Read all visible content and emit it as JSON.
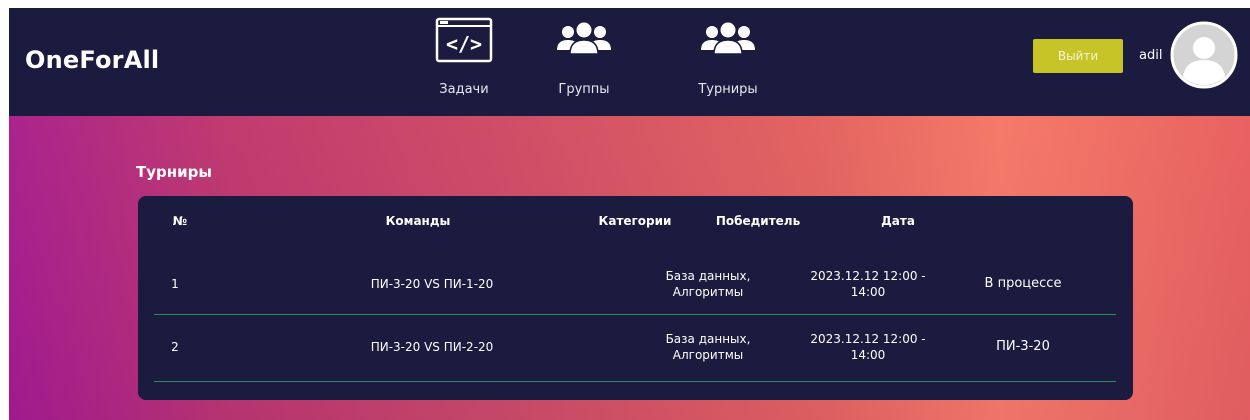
{
  "app": {
    "title": "OneForAll"
  },
  "nav": {
    "tasks_label": "Задачи",
    "groups_label": "Группы",
    "tournaments_label": "Турниры"
  },
  "user": {
    "logout_label": "Выйти",
    "username": "adil"
  },
  "page": {
    "title": "Турниры"
  },
  "table": {
    "headers": {
      "num": "№",
      "teams": "Команды",
      "categories": "Категории",
      "winner": "Победитель",
      "date": "Дата"
    },
    "rows": [
      {
        "num": "1",
        "teams": "ПИ-3-20 VS ПИ-1-20",
        "categories_line1": "База данных,",
        "categories_line2": "Алгоритмы",
        "date_line1": "2023.12.12 12:00 -",
        "date_line2": "14:00",
        "status": "В процессе"
      },
      {
        "num": "2",
        "teams": "ПИ-3-20 VS ПИ-2-20",
        "categories_line1": "База данных,",
        "categories_line2": "Алгоритмы",
        "date_line1": "2023.12.12 12:00 -",
        "date_line2": "14:00",
        "status": "ПИ-3-20"
      }
    ]
  },
  "colors": {
    "navbar": "#1a1b3e",
    "logout_button": "#c7c427",
    "row_divider": "#2f8a5b",
    "gradient_start": "#a21a90",
    "gradient_end": "#f47a68"
  },
  "icons": {
    "tasks": "code-window-icon",
    "groups": "people-group-icon",
    "tournaments": "people-group-icon",
    "avatar": "user-avatar-icon"
  }
}
